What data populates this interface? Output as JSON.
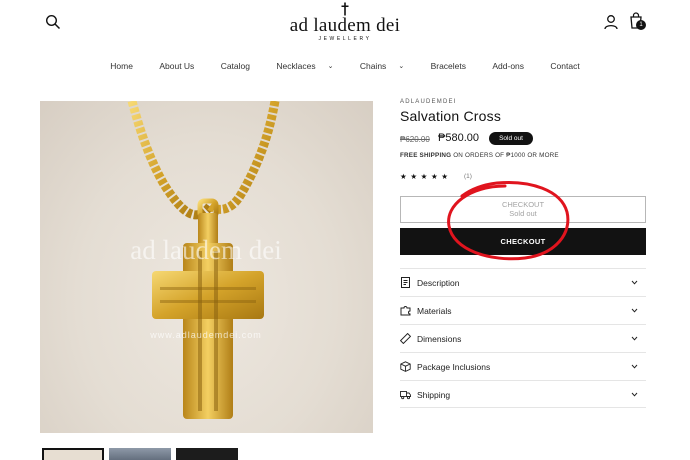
{
  "brand": {
    "name": "ad laudem dei",
    "subtitle": "JEWELLERY"
  },
  "cart": {
    "count": "1"
  },
  "nav": [
    {
      "label": "Home"
    },
    {
      "label": "About Us"
    },
    {
      "label": "Catalog"
    },
    {
      "label": "Necklaces",
      "dropdown": true
    },
    {
      "label": "Chains",
      "dropdown": true
    },
    {
      "label": "Bracelets"
    },
    {
      "label": "Add-ons"
    },
    {
      "label": "Contact"
    }
  ],
  "photo": {
    "watermark": "ad laudem dei",
    "site": "www.adlaudemdei.com"
  },
  "product": {
    "vendor": "ADLAUDEMDEI",
    "title": "Salvation Cross",
    "price_old": "₱620.00",
    "price_new": "₱580.00",
    "badge": "Sold out",
    "shipping_bold": "FREE SHIPPING",
    "shipping_rest": " ON ORDERS OF ₱1000 OR MORE",
    "stars": "★★★★★",
    "rating_count": "(1)"
  },
  "buttons": {
    "disabled_label": "CHECKOUT",
    "disabled_sub": "Sold out",
    "checkout": "CHECKOUT"
  },
  "accordion": [
    {
      "label": "Description",
      "icon": "document-icon"
    },
    {
      "label": "Materials",
      "icon": "puzzle-icon"
    },
    {
      "label": "Dimensions",
      "icon": "ruler-icon"
    },
    {
      "label": "Package Inclusions",
      "icon": "box-icon"
    },
    {
      "label": "Shipping",
      "icon": "truck-icon"
    }
  ],
  "colors": {
    "text": "#121212",
    "annotation": "#e0141e",
    "button": "#121212"
  }
}
